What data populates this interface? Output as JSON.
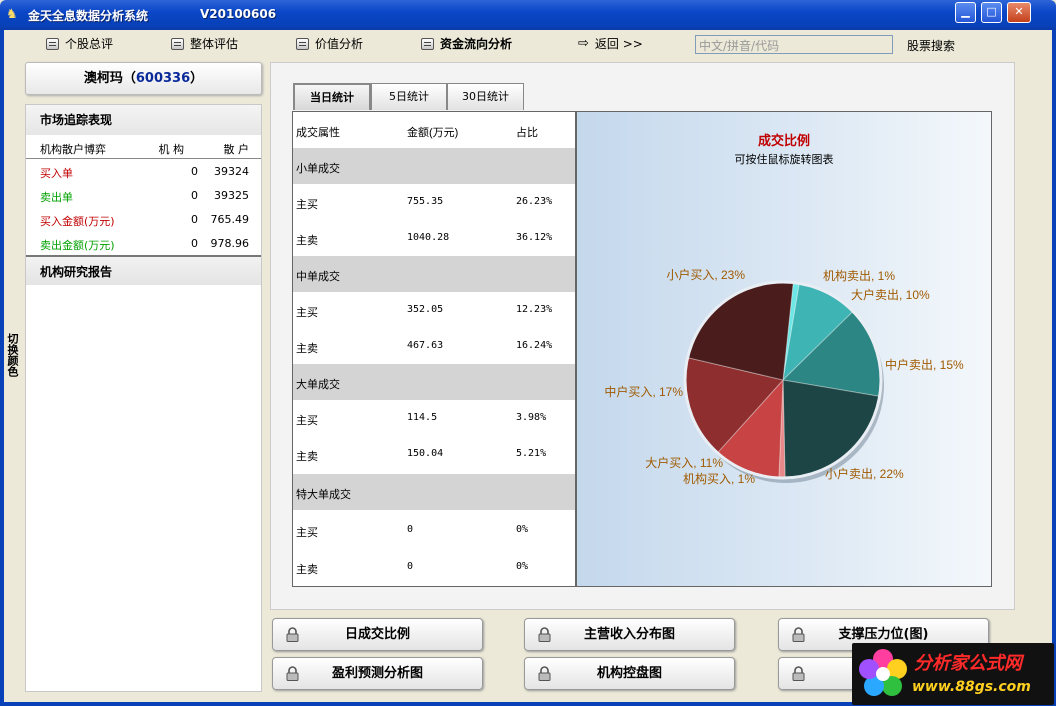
{
  "window": {
    "title": "金天全息数据分析系统",
    "version": "V20100606",
    "min_glyph": "▁",
    "max_glyph": "□",
    "close_glyph": "✕"
  },
  "toolbar": {
    "items": [
      {
        "label": "个股总评",
        "icon": "document-icon"
      },
      {
        "label": "整体评估",
        "icon": "document-icon"
      },
      {
        "label": "价值分析",
        "icon": "document-icon"
      },
      {
        "label": "资金流向分析",
        "icon": "checked-document-icon",
        "active": true
      },
      {
        "label": "返回 >>",
        "icon": "back-arrow-icon"
      }
    ],
    "search_placeholder": "中文/拼音/代码",
    "search_label": "股票搜索"
  },
  "side_strip": {
    "label": "切换颜色"
  },
  "stock": {
    "name": "澳柯玛",
    "code": "600336"
  },
  "market": {
    "title": "市场追踪表现",
    "headers": [
      "机构散户博弈",
      "机 构",
      "散 户"
    ],
    "rows": [
      {
        "label": "买入单",
        "inst": "0",
        "retail": "39324",
        "color": "#c00000"
      },
      {
        "label": "卖出单",
        "inst": "0",
        "retail": "39325",
        "color": "#00a000"
      },
      {
        "label": "买入金额(万元)",
        "inst": "0",
        "retail": "765.49",
        "color": "#c00000"
      },
      {
        "label": "卖出金额(万元)",
        "inst": "0",
        "retail": "978.96",
        "color": "#00a000"
      }
    ],
    "report_title": "机构研究报告"
  },
  "tabs": [
    "当日统计",
    "5日统计",
    "30日统计"
  ],
  "table": {
    "headers": [
      "成交属性",
      "金额(万元)",
      "占比"
    ],
    "sections": [
      {
        "name": "小单成交",
        "rows": [
          [
            "主买",
            "755.35",
            "26.23%"
          ],
          [
            "主卖",
            "1040.28",
            "36.12%"
          ]
        ]
      },
      {
        "name": "中单成交",
        "rows": [
          [
            "主买",
            "352.05",
            "12.23%"
          ],
          [
            "主卖",
            "467.63",
            "16.24%"
          ]
        ]
      },
      {
        "name": "大单成交",
        "rows": [
          [
            "主买",
            "114.5",
            "3.98%"
          ],
          [
            "主卖",
            "150.04",
            "5.21%"
          ]
        ]
      },
      {
        "name": "特大单成交",
        "rows": [
          [
            "主买",
            "0",
            "0%"
          ],
          [
            "主卖",
            "0",
            "0%"
          ]
        ]
      }
    ]
  },
  "chart_data": {
    "type": "pie",
    "title": "成交比例",
    "subtitle": "可按住鼠标旋转图表",
    "slices": [
      {
        "label": "机构卖出, 1%",
        "value": 1,
        "color": "#6ee6e6"
      },
      {
        "label": "大户卖出, 10%",
        "value": 10,
        "color": "#3fb4b4"
      },
      {
        "label": "中户卖出, 15%",
        "value": 15,
        "color": "#2c8683"
      },
      {
        "label": "小户卖出, 22%",
        "value": 22,
        "color": "#1e4545"
      },
      {
        "label": "机构买入, 1%",
        "value": 1,
        "color": "#e88888"
      },
      {
        "label": "大户买入, 11%",
        "value": 11,
        "color": "#c84444"
      },
      {
        "label": "中户买入, 17%",
        "value": 17,
        "color": "#8e2e2e"
      },
      {
        "label": "小户买入, 23%",
        "value": 23,
        "color": "#4a1c1c"
      }
    ]
  },
  "buttons": [
    {
      "label": "日成交比例"
    },
    {
      "label": "主营收入分布图"
    },
    {
      "label": "支撑压力位(图)"
    },
    {
      "label": "盈利预测分析图"
    },
    {
      "label": "机构控盘图"
    },
    {
      "label": ""
    }
  ],
  "watermark": {
    "line1": "分析家公式网",
    "line2": "www.88gs.com"
  }
}
